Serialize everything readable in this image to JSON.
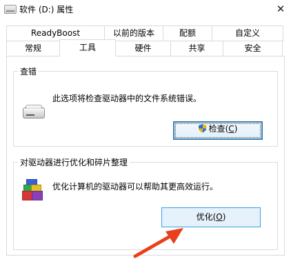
{
  "window": {
    "title": "软件 (D:) 属性",
    "close_glyph": "✕",
    "icon": "drive-icon"
  },
  "tabs": {
    "row1": [
      "ReadyBoost",
      "以前的版本",
      "配额",
      "自定义"
    ],
    "row2": [
      "常规",
      "工具",
      "硬件",
      "共享",
      "安全"
    ],
    "active": "工具"
  },
  "error_checking": {
    "title": "查错",
    "description": "此选项将检查驱动器中的文件系统错误。",
    "button_label": "检查(",
    "button_key": "C",
    "button_tail": ")",
    "button_icon": "uac-shield-icon"
  },
  "optimize": {
    "title": "对驱动器进行优化和碎片整理",
    "description": "优化计算机的驱动器可以帮助其更高效运行。",
    "button_label": "优化(",
    "button_key": "O",
    "button_tail": ")",
    "icon": "defrag-icon"
  },
  "annotation": {
    "arrow_color": "#e8401c"
  }
}
